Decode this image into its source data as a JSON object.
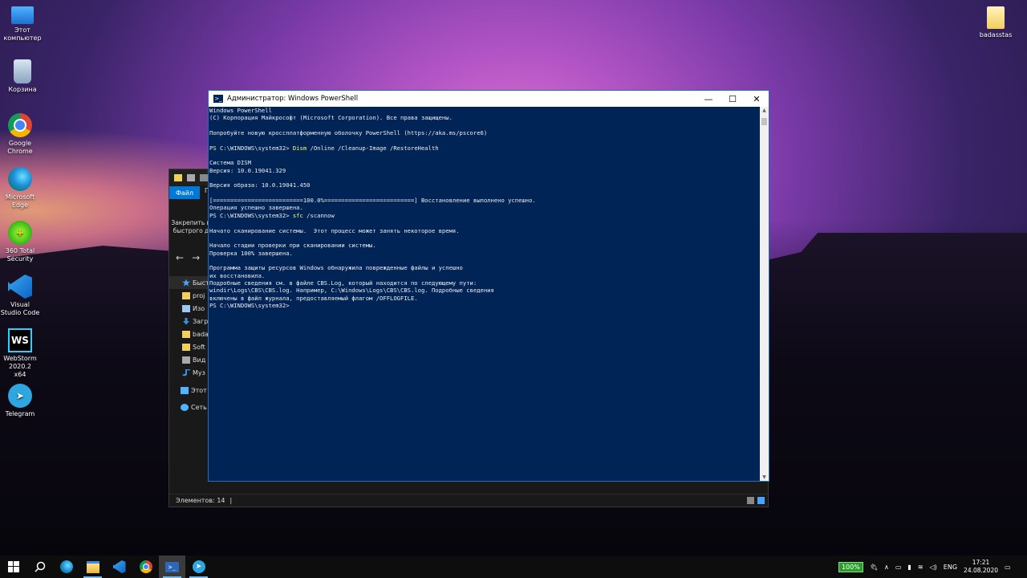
{
  "desktop": {
    "icons_left": [
      {
        "label": "Этот компьютер",
        "icon": "computer-icon"
      },
      {
        "label": "Корзина",
        "icon": "recycle-bin-icon"
      },
      {
        "label": "Google Chrome",
        "icon": "chrome-icon"
      },
      {
        "label": "Microsoft Edge",
        "icon": "edge-icon"
      },
      {
        "label": "360 Total Security",
        "icon": "360-security-icon"
      },
      {
        "label": "Visual Studio Code",
        "icon": "vscode-icon"
      },
      {
        "label": "WebStorm 2020.2 x64",
        "icon": "webstorm-icon"
      },
      {
        "label": "Telegram",
        "icon": "telegram-icon"
      }
    ],
    "icon_right": {
      "label": "badasstas",
      "icon": "folder-icon"
    },
    "ws_badge": "WS",
    "t360_glyph": "+",
    "tg_glyph": "➤"
  },
  "explorer": {
    "ribbon_file_tab": "Файл",
    "ribbon_tab2": "Г",
    "pin_text_line1": "Закрепить н",
    "pin_text_line2": "быстрого д",
    "nav_back": "←",
    "nav_forward": "→",
    "sidebar_items": [
      "Быст",
      "proj",
      "Изо",
      "Загр",
      "bada",
      "Soft",
      "Вид",
      "Муз",
      "Этот к",
      "Сеть"
    ],
    "status_items": "Элементов: 14",
    "status_sep": "|"
  },
  "powershell": {
    "title": "Администратор: Windows PowerShell",
    "title_icon_glyph": ">_",
    "minimize": "—",
    "maximize": "☐",
    "close": "✕",
    "lines": [
      "Windows PowerShell",
      "(C) Корпорация Майкрософт (Microsoft Corporation). Все права защищены.",
      "",
      "Попробуйте новую кроссплатформенную оболочку PowerShell (https://aka.ms/pscore6)",
      "",
      {
        "prompt": "PS C:\\WINDOWS\\system32> ",
        "cmd": "Dism",
        "rest": " /Online /Cleanup-Image /RestoreHealth"
      },
      "",
      "Система DISM",
      "Версия: 10.0.19041.329",
      "",
      "Версия образа: 10.0.19041.450",
      "",
      "[==========================100.0%==========================] Восстановление выполнено успешно.",
      "Операция успешно завершена.",
      {
        "prompt": "PS C:\\WINDOWS\\system32> ",
        "cmd": "sfc",
        "rest": " /scannow"
      },
      "",
      "Начато сканирование системы.  Этот процесс может занять некоторое время.",
      "",
      "Начало стадии проверки при сканировании системы.",
      "Проверка 100% завершена.",
      "",
      "Программа защиты ресурсов Windows обнаружила поврежденные файлы и успешно",
      "их восстановила.",
      "Подробные сведения см. в файле CBS.Log, который находится по следующему пути:",
      "windir\\Logs\\CBS\\CBS.log. Например, C:\\Windows\\Logs\\CBS\\CBS.log. Подробные сведения",
      "включены в файл журнала, предоставляемый флагом /OFFLOGFILE.",
      "PS C:\\WINDOWS\\system32>"
    ],
    "colors": {
      "background": "#012456",
      "text": "#eeedf0",
      "command": "#fffd7e"
    }
  },
  "taskbar": {
    "apps": [
      {
        "name": "start",
        "glyph": "⊞",
        "icon": "windows-start-icon"
      },
      {
        "name": "search",
        "glyph": "⚲",
        "icon": "search-icon"
      },
      {
        "name": "edge",
        "icon": "edge-icon"
      },
      {
        "name": "explorer",
        "icon": "file-explorer-icon"
      },
      {
        "name": "vscode",
        "icon": "vscode-icon"
      },
      {
        "name": "chrome",
        "icon": "chrome-icon"
      },
      {
        "name": "powershell",
        "glyph": ">_",
        "icon": "powershell-icon"
      },
      {
        "name": "telegram",
        "glyph": "➤",
        "icon": "telegram-icon"
      }
    ],
    "battery": "100%",
    "tray_chevron": "∧",
    "language": "ENG",
    "time": "17:21",
    "date": "24.08.2020",
    "notifications_glyph": "▭"
  }
}
